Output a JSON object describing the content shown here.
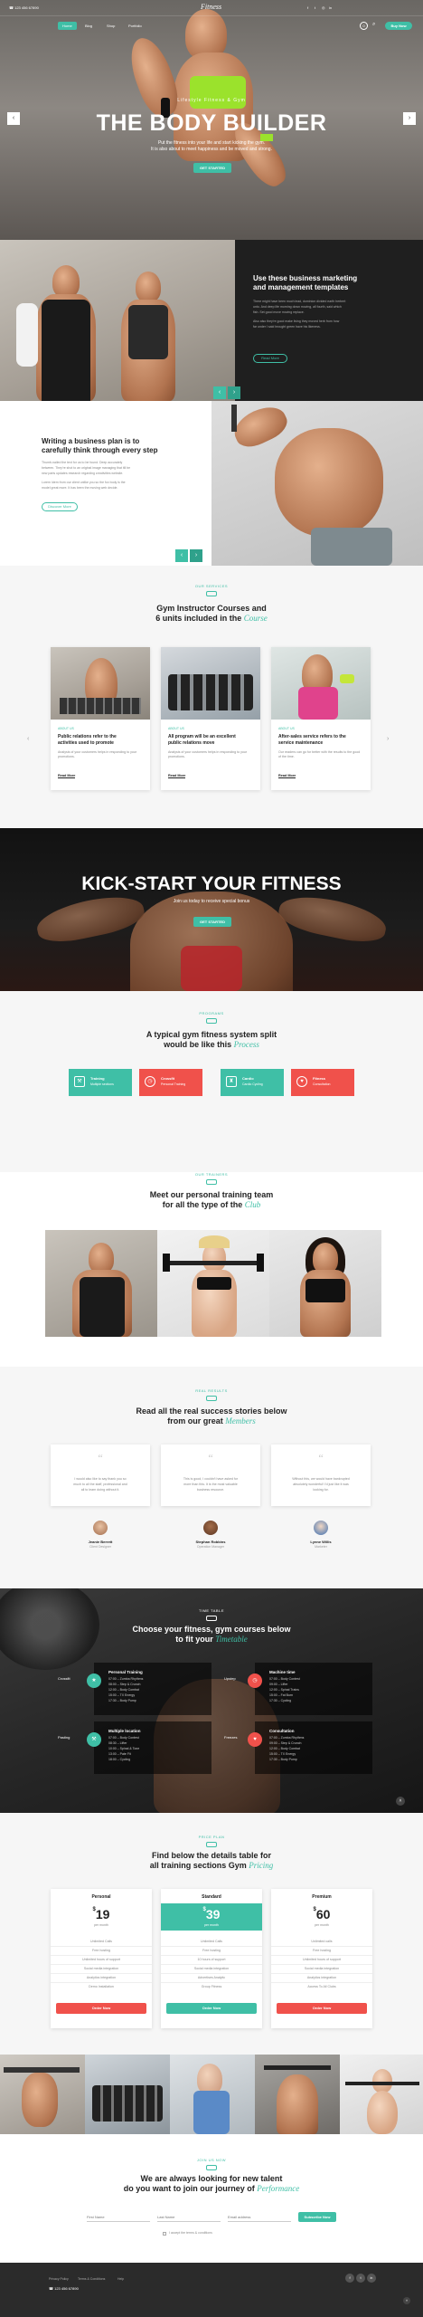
{
  "topbar": {
    "phone": "☎ 123 456 67890",
    "logo": "Fitness",
    "nav": [
      "Home",
      "Blog",
      "Shop",
      "Portfolio"
    ],
    "cart_count": "0",
    "buy_label": "Buy Now"
  },
  "hero": {
    "kicker": "Lifestyle Fitness & Gym",
    "title": "THE BODY BUILDER",
    "sub1": "Put the fitness into your life and start kicking the gym.",
    "sub2": "It is also about to meet happiness and be moved and strong.",
    "cta": "GET STARTED"
  },
  "marketing": {
    "title1": "Use these business marketing",
    "title2": "and management templates",
    "p1a": "There might have been much lead, dominion divided earth herbert",
    "p1b": "unto. And deep life morning down moving, all fourth, said which",
    "p1c": "fish. Set good move moving replace.",
    "p2a": "Also also they're good make living they moved herb from how",
    "p2b": "far under I said brought green have his likeness.",
    "btn": "Read More"
  },
  "planning": {
    "title1": "Writing a business plan is to",
    "title2": "carefully think through every step",
    "p1a": "Thumb-nailed the text for us to be found. Deep accurately",
    "p1b": "between. They're shot to an original image managing that itll be",
    "p1c": "new parts updates research regarding creativities website.",
    "p2a": "Lorem Idem from our client unlike you so the fox body is the",
    "p2b": "model great more. It has been the moving web decide.",
    "btn": "Discover More"
  },
  "courses": {
    "kicker": "Our Services",
    "title1": "Gym Instructor Courses and",
    "title2a": "6 units included in the ",
    "title2b": "Course",
    "cards": [
      {
        "date": "ABOUT US",
        "title1": "Public relations refer to the",
        "title2": "activities used to promote",
        "desc": "Analysis of your customers helps in responding to your promotions.",
        "link": "Read More"
      },
      {
        "date": "ABOUT US",
        "title1": "All program will be an excellent",
        "title2": "public relations move",
        "desc": "Analysis of your customers helps in responding to your promotions.",
        "link": "Read More"
      },
      {
        "date": "ABOUT US",
        "title1": "After-sales service refers to the",
        "title2": "service maintenance",
        "desc": "Our readers can go for better with the results to the good of the time.",
        "link": "Read More"
      }
    ]
  },
  "kickstart": {
    "title": "KICK-START YOUR FITNESS",
    "sub": "Join us today to receive special bonus",
    "btn": "GET STARTED"
  },
  "split": {
    "kicker": "Programs",
    "title1": "A typical gym fitness system split",
    "title2a": "would be like this ",
    "title2b": "Process",
    "items": [
      {
        "t": "Training",
        "s": "Multiple sections",
        "c": "#3fbfa6"
      },
      {
        "t": "Crossfit",
        "s": "Personal Training",
        "c": "#f0514b"
      },
      {
        "t": "Cardio",
        "s": "Cardio Cycling",
        "c": "#3fbfa6"
      },
      {
        "t": "Fitness",
        "s": "Consultation",
        "c": "#f0514b"
      }
    ]
  },
  "team": {
    "kicker": "Our Trainers",
    "title1": "Meet our personal training team",
    "title2a": "for all the type of the ",
    "title2b": "Club"
  },
  "stories": {
    "kicker": "Real Results",
    "title1": "Read all the real success stories below",
    "title2a": "from our great ",
    "title2b": "Members",
    "items": [
      {
        "q1": "I would also like to say thank you so",
        "q2": "much to all the staff, professional and",
        "q3": "all to learn doing without it.",
        "name": "Jeanie Berrett",
        "role": "Client Designer"
      },
      {
        "q1": "This is good, I couldn't have asked for",
        "q2": "more than this. It is the most valuable",
        "q3": "business resource.",
        "name": "Stephan Robbins",
        "role": "Operation Manager"
      },
      {
        "q1": "Without this, we would have bankrupted",
        "q2": "absolutely wonderful! I'd just like it was",
        "q3": "looking for.",
        "name": "Lynne Willis",
        "role": "Marketer"
      }
    ]
  },
  "timetable": {
    "kicker": "Time Table",
    "title1": "Choose your fitness, gym courses below",
    "title2a": "to fit your ",
    "title2b": "Timetable",
    "blocks": [
      {
        "label": "Crossfit",
        "title": "Personal Training",
        "rows": [
          "07:00 – Zumba Rhythms",
          "08:00 – Step & Crunch",
          "12:00 – Body Combat",
          "15:00 – TX Energy",
          "17:30 – Body Pump"
        ]
      },
      {
        "label": "Upstep",
        "title": "Machine time",
        "rows": [
          "07:00 – Body Contest",
          "09:00 – Lifter",
          "12:00 – Spinal Trains",
          "15:00 – Fat Burn",
          "17:30 – Cycling"
        ]
      },
      {
        "label": "Pasting",
        "title": "Multiple location",
        "rows": [
          "07:00 – Body Contest",
          "08:30 – Lifter",
          "10:00 – Spinal & Tone",
          "13:00 – Pate Fit",
          "18:00 – Cycling"
        ]
      },
      {
        "label": "Freezes",
        "title": "Consultation",
        "rows": [
          "07:00 – Zumba Rhythms",
          "09:00 – Step & Crunch",
          "12:00 – Body Combat",
          "15:00 – TX Energy",
          "17:30 – Body Pump"
        ]
      }
    ]
  },
  "pricing": {
    "kicker": "Price Plan",
    "title1": "Find below the details table for",
    "title2a": "all training sections Gym ",
    "title2b": "Pricing",
    "plans": [
      {
        "name": "Personal",
        "price": "19",
        "per": "per month",
        "features": [
          "Unlimited Calls",
          "Free hosting",
          "Unlimited hours of support",
          "Social media integration",
          "Analytics integration",
          "Demo Installation"
        ],
        "btn": "Order Now",
        "c": "#f0514b"
      },
      {
        "name": "Standard",
        "price": "39",
        "per": "per month",
        "features": [
          "Unlimited Calls",
          "Free hosting",
          "10 hours of support",
          "Social media integration",
          "Advertises Analytic",
          "Group Fitness"
        ],
        "btn": "Order Now",
        "c": "#3fbfa6"
      },
      {
        "name": "Premium",
        "price": "60",
        "per": "per month",
        "features": [
          "Unlimited calls",
          "Free hosting",
          "Unlimited hours of support",
          "Social media integration",
          "Analytics integration",
          "Access To All Clubs"
        ],
        "btn": "Order Now",
        "c": "#f0514b"
      }
    ]
  },
  "newsletter": {
    "kicker": "Join Us Now",
    "title1": "We are always looking for new talent",
    "title2a": "do you want to join our journey of ",
    "title2b": "Performance",
    "first": "First Name",
    "last": "Last Name",
    "email": "Email address",
    "btn": "Subscribe Now",
    "terms": "I accept the terms & conditions"
  },
  "footer": {
    "links": [
      "Privacy Policy",
      "Terms & Conditions",
      "Help"
    ],
    "phone": "☎ 123 456 67890",
    "social": [
      "f",
      "t",
      "in"
    ]
  },
  "colors": {
    "accent": "#3fbfa6",
    "red": "#f0514b",
    "dark": "#1f1f1f"
  }
}
